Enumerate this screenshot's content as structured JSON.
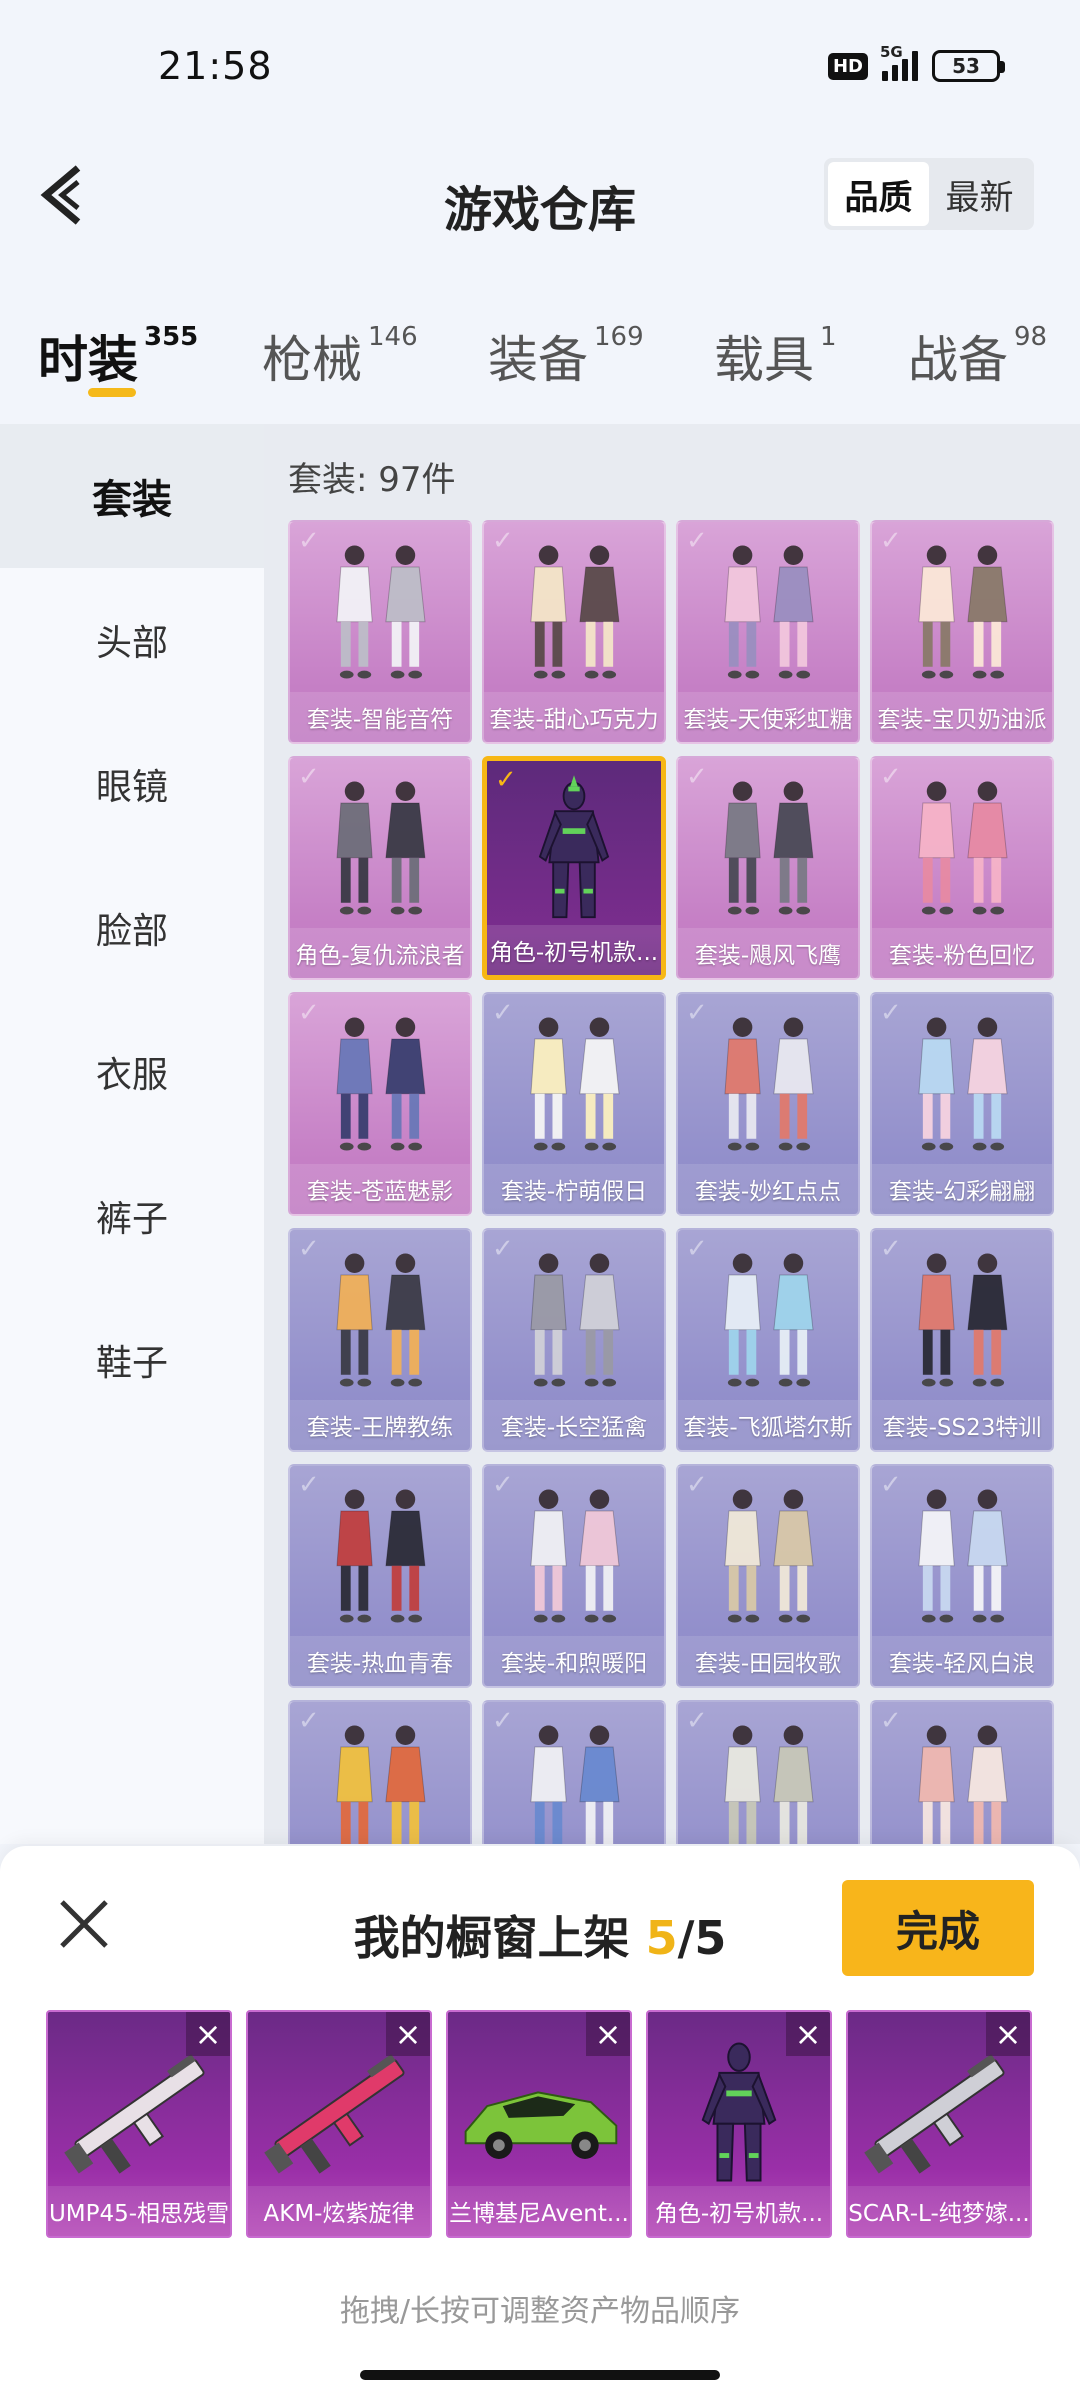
{
  "status": {
    "time": "21:58",
    "hd": "HD",
    "network": "5G",
    "battery": "53"
  },
  "header": {
    "title": "游戏仓库",
    "sort_quality": "品质",
    "sort_latest": "最新"
  },
  "tabs": [
    {
      "label": "时装",
      "count": "355"
    },
    {
      "label": "枪械",
      "count": "146"
    },
    {
      "label": "装备",
      "count": "169"
    },
    {
      "label": "载具",
      "count": "1"
    },
    {
      "label": "战备",
      "count": "98"
    }
  ],
  "sidebar": {
    "items": [
      "套装",
      "头部",
      "眼镜",
      "脸部",
      "衣服",
      "裤子",
      "鞋子"
    ]
  },
  "main": {
    "count_label": "套装: 97件",
    "items": [
      {
        "label": "套装-智能音符",
        "rarity": "pink"
      },
      {
        "label": "套装-甜心巧克力",
        "rarity": "pink"
      },
      {
        "label": "套装-天使彩虹糖",
        "rarity": "pink"
      },
      {
        "label": "套装-宝贝奶油派",
        "rarity": "pink"
      },
      {
        "label": "角色-复仇流浪者",
        "rarity": "pink"
      },
      {
        "label": "角色-初号机款...",
        "rarity": "selected"
      },
      {
        "label": "套装-飓风飞鹰",
        "rarity": "pink"
      },
      {
        "label": "套装-粉色回忆",
        "rarity": "pink"
      },
      {
        "label": "套装-苍蓝魅影",
        "rarity": "pink"
      },
      {
        "label": "套装-柠萌假日",
        "rarity": "purple"
      },
      {
        "label": "套装-妙红点点",
        "rarity": "purple"
      },
      {
        "label": "套装-幻彩翩翩",
        "rarity": "purple"
      },
      {
        "label": "套装-王牌教练",
        "rarity": "purple"
      },
      {
        "label": "套装-长空猛禽",
        "rarity": "purple"
      },
      {
        "label": "套装-飞狐塔尔斯",
        "rarity": "purple"
      },
      {
        "label": "套装-SS23特训",
        "rarity": "purple"
      },
      {
        "label": "套装-热血青春",
        "rarity": "purple"
      },
      {
        "label": "套装-和煦暖阳",
        "rarity": "purple"
      },
      {
        "label": "套装-田园牧歌",
        "rarity": "purple"
      },
      {
        "label": "套装-轻风白浪",
        "rarity": "purple"
      },
      {
        "label": "",
        "rarity": "purple"
      },
      {
        "label": "",
        "rarity": "purple"
      },
      {
        "label": "",
        "rarity": "purple"
      },
      {
        "label": "",
        "rarity": "purple"
      }
    ]
  },
  "sheet": {
    "title": "我的橱窗上架",
    "current": "5",
    "sep_total": "/5",
    "done_label": "完成",
    "hint": "拖拽/长按可调整资产物品顺序",
    "items": [
      {
        "label": "UMP45-相思残雪",
        "kind": "gun"
      },
      {
        "label": "AKM-炫紫旋律",
        "kind": "rifle"
      },
      {
        "label": "兰博基尼Avent...",
        "kind": "car"
      },
      {
        "label": "角色-初号机款...",
        "kind": "figure"
      },
      {
        "label": "SCAR-L-纯梦嫁...",
        "kind": "gun2"
      }
    ]
  },
  "colors": {
    "accent": "#f8b51b",
    "rarity_pink": "#c57fc5",
    "rarity_purple": "#928fcb"
  }
}
